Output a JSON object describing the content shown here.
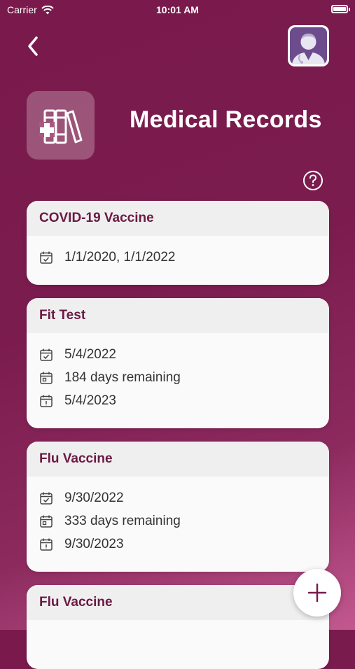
{
  "status": {
    "carrier": "Carrier",
    "time": "10:01 AM"
  },
  "header": {
    "title": "Medical Records"
  },
  "records": [
    {
      "title": "COVID-19 Vaccine",
      "date": "1/1/2020, 1/1/2022"
    },
    {
      "title": "Fit Test",
      "date": "5/4/2022",
      "remaining": "184 days remaining",
      "expires": "5/4/2023"
    },
    {
      "title": "Flu Vaccine",
      "date": "9/30/2022",
      "remaining": "333 days remaining",
      "expires": "9/30/2023"
    },
    {
      "title": "Flu Vaccine"
    }
  ],
  "icons": {
    "back": "chevron-left-icon",
    "avatar": "doctor-avatar",
    "header": "medical-books-icon",
    "help": "question-circle-icon",
    "date": "calendar-check-icon",
    "remaining": "calendar-icon",
    "expires": "calendar-alert-icon",
    "add": "plus-icon"
  },
  "colors": {
    "accent": "#7a1a4c",
    "card_title": "#6b1a44"
  }
}
